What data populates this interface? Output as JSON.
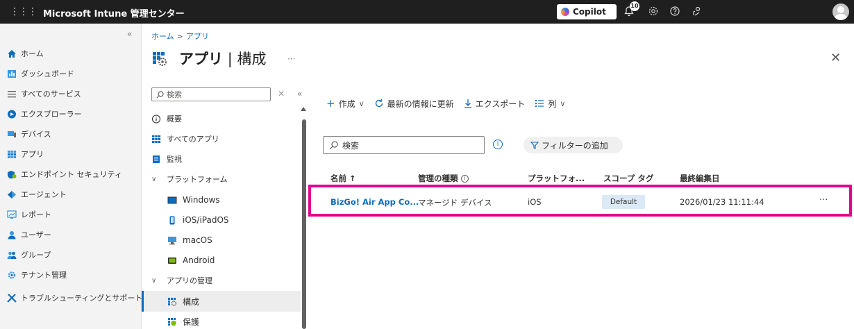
{
  "topbar": {
    "waffle": "⋮⋮⋮",
    "brand": "Microsoft Intune 管理センター",
    "copilot_label": "Copilot",
    "notification_count": "10",
    "icons": [
      "bell-icon",
      "settings-icon",
      "help-icon",
      "feedback-icon",
      "avatar"
    ]
  },
  "leftnav": {
    "collapse": "«",
    "items": [
      {
        "label": "ホーム",
        "icon": "home-icon"
      },
      {
        "label": "ダッシュボード",
        "icon": "dashboard-icon"
      },
      {
        "label": "すべてのサービス",
        "icon": "list-icon"
      },
      {
        "label": "エクスプローラー",
        "icon": "explorer-icon"
      },
      {
        "label": "デバイス",
        "icon": "devices-icon"
      },
      {
        "label": "アプリ",
        "icon": "apps-icon"
      },
      {
        "label": "エンドポイント セキュリティ",
        "icon": "shield-icon"
      },
      {
        "label": "エージェント",
        "icon": "agent-icon"
      },
      {
        "label": "レポート",
        "icon": "reports-icon"
      },
      {
        "label": "ユーザー",
        "icon": "user-icon"
      },
      {
        "label": "グループ",
        "icon": "group-icon"
      },
      {
        "label": "テナント管理",
        "icon": "tenant-icon"
      },
      {
        "label": "トラブルシューティングとサポート",
        "icon": "troubleshoot-icon"
      }
    ]
  },
  "breadcrumb": {
    "home": "ホーム",
    "sep": ">",
    "current": "アプリ"
  },
  "page": {
    "title_main": "アプリ",
    "title_sep": "|",
    "title_sub": "構成",
    "more": "···",
    "close": "✕"
  },
  "subnav": {
    "search_placeholder": "検索",
    "clear": "✕",
    "collapse": "«",
    "items": [
      {
        "label": "概要"
      },
      {
        "label": "すべてのアプリ"
      },
      {
        "label": "監視"
      },
      {
        "label": "プラットフォーム"
      },
      {
        "label": "Windows"
      },
      {
        "label": "iOS/iPadOS"
      },
      {
        "label": "macOS"
      },
      {
        "label": "Android"
      },
      {
        "label": "アプリの管理"
      },
      {
        "label": "構成"
      },
      {
        "label": "保護"
      }
    ]
  },
  "toolbar": {
    "create": "作成",
    "refresh": "最新の情報に更新",
    "export": "エクスポート",
    "columns": "列"
  },
  "search": {
    "placeholder": "検索"
  },
  "filter": {
    "label": "フィルターの追加"
  },
  "table": {
    "headers": [
      "名前 ↑",
      "管理の種類",
      "プラットフォ...",
      "スコープ タグ",
      "最終編集日"
    ],
    "rows": [
      {
        "name": "BizGo! Air App Co...",
        "type": "マネージド デバイス",
        "platform": "iOS",
        "scope": "Default",
        "modified": "2026/01/23 11:11:44",
        "more": "···"
      }
    ]
  },
  "colors": {
    "accent": "#0f6cbd",
    "highlight": "#e3008c",
    "topbar": "#1f1f1f"
  }
}
